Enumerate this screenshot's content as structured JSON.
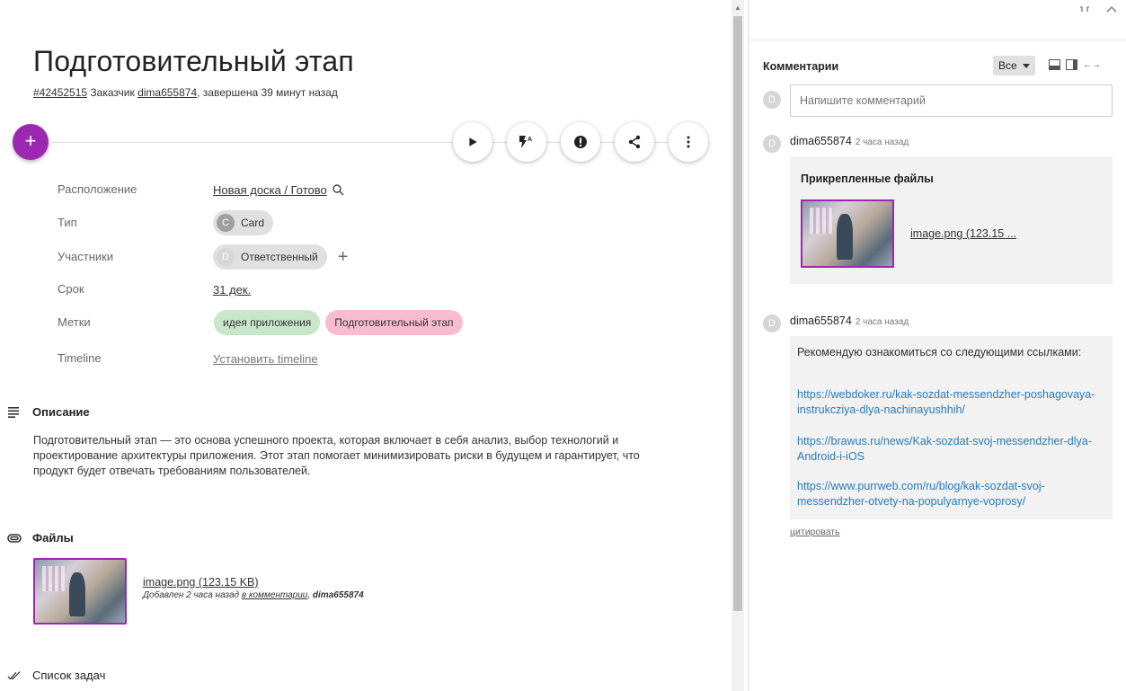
{
  "task": {
    "title": "Подготовительный этап",
    "id_link": "#42452515",
    "customer_prefix": "Заказчик",
    "customer": "dima655874",
    "completed": ", завершена 39 минут назад"
  },
  "actions": {
    "add": "+",
    "play_icon": "play-icon",
    "flash_icon": "flash-auto-icon",
    "alert_icon": "alert-icon",
    "share_icon": "share-icon",
    "more_icon": "more-vert-icon"
  },
  "props": {
    "location": {
      "label": "Расположение",
      "value": "Новая доска / Готово"
    },
    "type": {
      "label": "Тип",
      "avatar": "C",
      "value": "Card"
    },
    "members": {
      "label": "Участники",
      "avatar": "D",
      "value": "Ответственный",
      "add": "+"
    },
    "due": {
      "label": "Срок",
      "value": "31 дек."
    },
    "tags": {
      "label": "Метки",
      "items": [
        "идея приложения",
        "Подготовительный этап"
      ]
    },
    "timeline": {
      "label": "Timeline",
      "value": "Установить timeline"
    }
  },
  "description": {
    "heading": "Описание",
    "text": "Подготовительный этап — это основа успешного проекта, которая включает в себя анализ, выбор технологий и проектирование архитектуры приложения. Этот этап помогает минимизировать риски в будущем и гарантирует, что продукт будет отвечать требованиям пользователей."
  },
  "files": {
    "heading": "Файлы",
    "name": "image.png (123.15 KB)",
    "added_prefix": "Добавлен 2 часа назад",
    "added_link": "в комментарии",
    "added_by": "dima655874"
  },
  "checklist": {
    "heading": "Список задач"
  },
  "comments": {
    "title": "Комментарии",
    "filter": "Все",
    "avatar": "D",
    "placeholder": "Напишите комментарий",
    "items": [
      {
        "author": "dima655874",
        "time": "2 часа назад",
        "attach_title": "Прикрепленные файлы",
        "attach_name": "image.png (123.15 ..."
      },
      {
        "author": "dima655874",
        "time": "2 часа назад",
        "text": "Рекомендую ознакомиться со следующими ссылками:",
        "links": [
          "https://webdoker.ru/kak-sozdat-messendzher-poshagovaya-instrukcziya-dlya-nachinayushhih/",
          "https://brawus.ru/news/Kak-sozdat-svoj-messendzher-dlya-Android-i-iOS",
          "https://www.purrweb.com/ru/blog/kak-sozdat-svoj-messendzher-otvety-na-populyarnye-voprosy/"
        ]
      }
    ],
    "quote": "цитировать"
  },
  "colors": {
    "accent": "#9c27b0",
    "tag_green": "#c8e6c9",
    "tag_pink": "#f8bbd0",
    "link_blue": "#2a7ab9"
  }
}
